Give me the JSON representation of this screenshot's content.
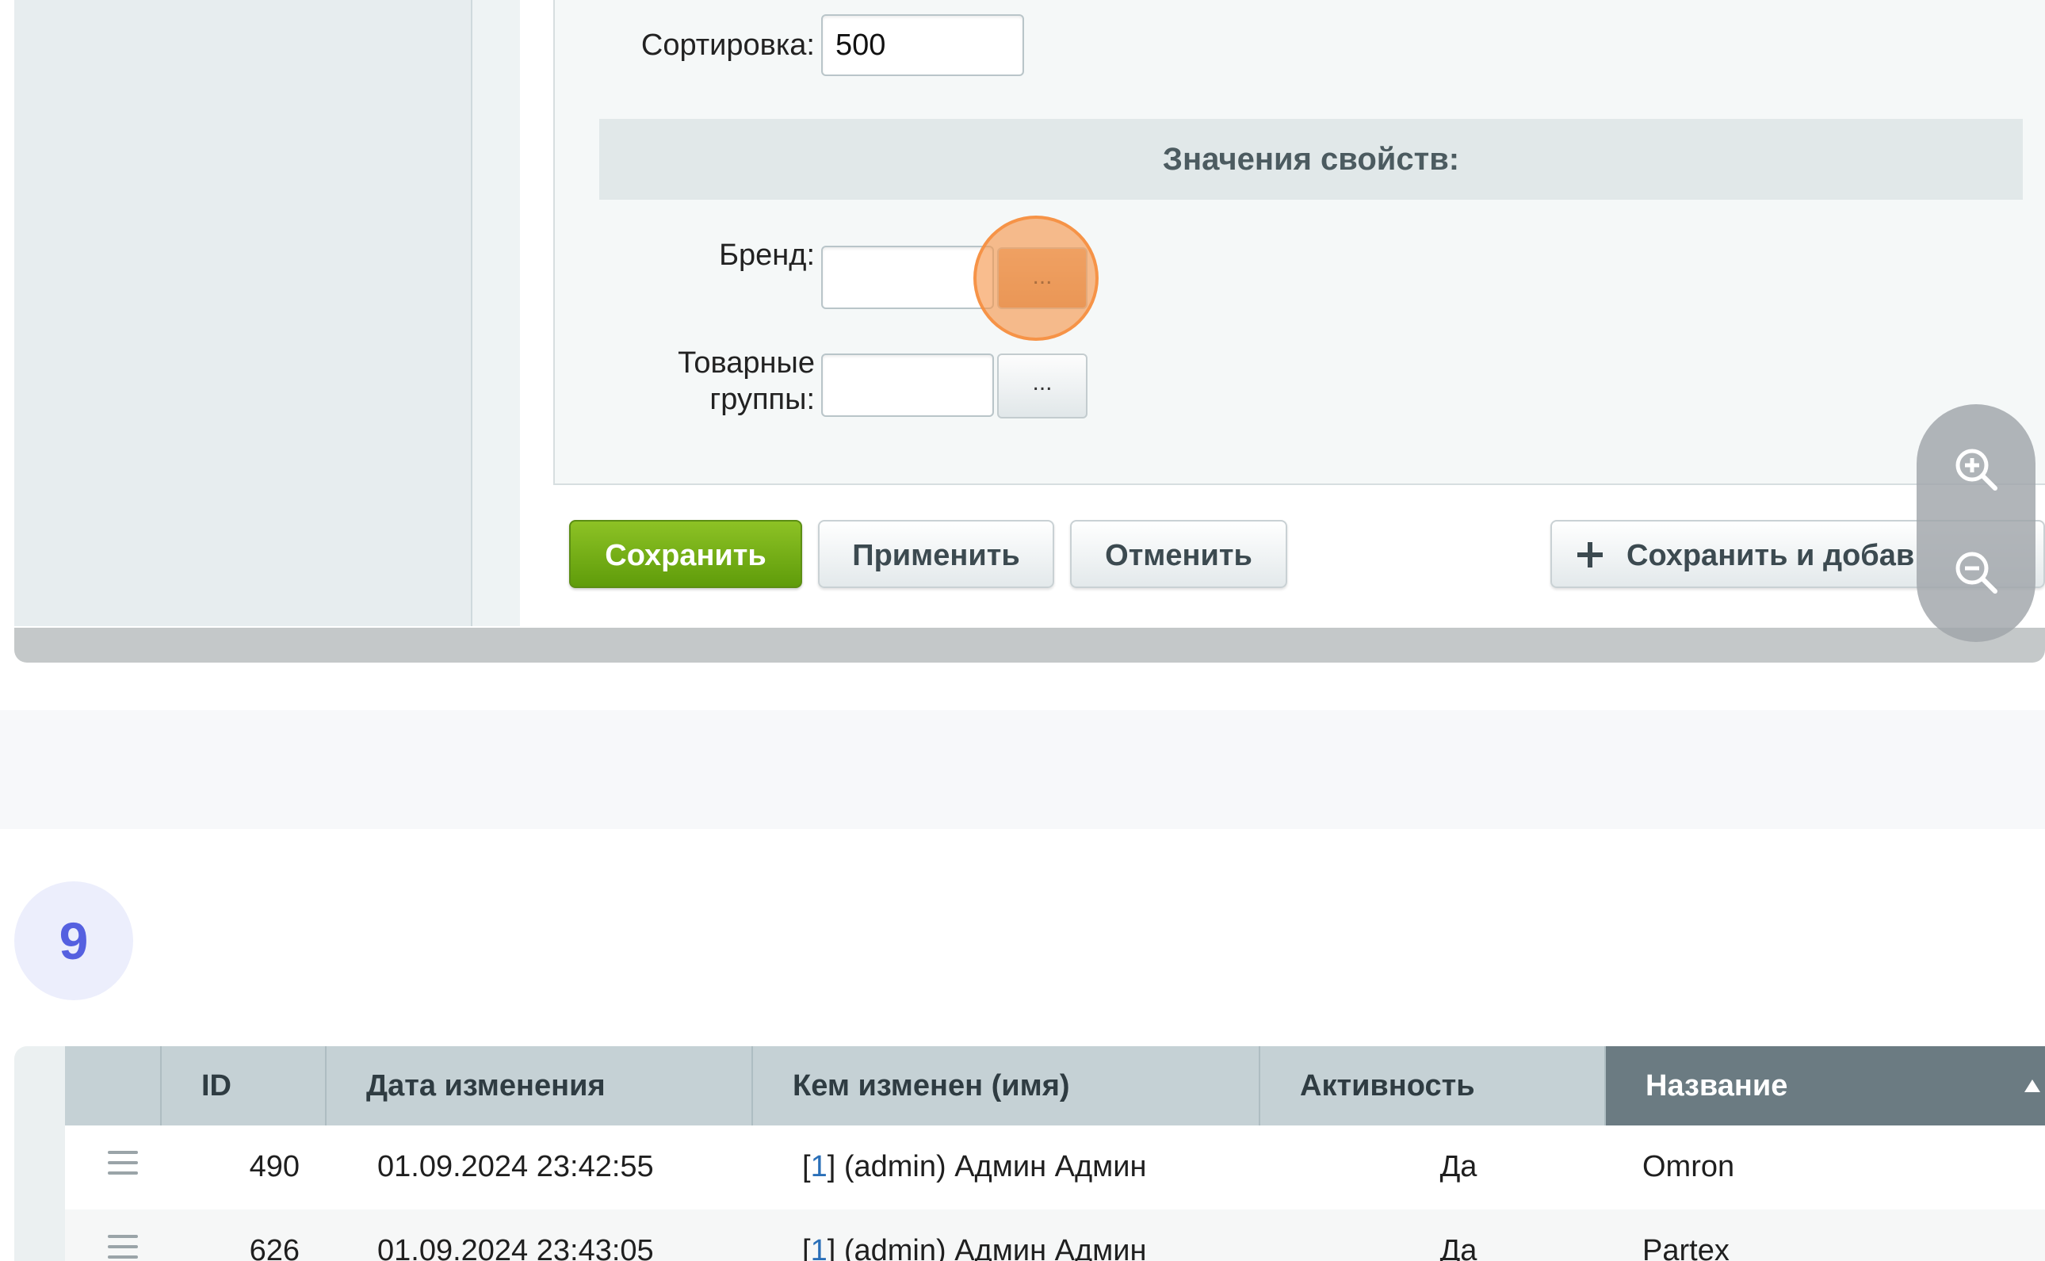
{
  "form": {
    "sort_label": "Сортировка:",
    "sort_value": "500",
    "section_title": "Значения свойств:",
    "brand_label": "Бренд:",
    "brand_value": "",
    "groups_label_line1": "Товарные",
    "groups_label_line2": "группы:",
    "groups_value": "",
    "picker_button": "...",
    "highlight_color": "#f69448"
  },
  "buttons": {
    "save": "Сохранить",
    "apply": "Применить",
    "cancel": "Отменить",
    "save_add": "Сохранить и добав"
  },
  "zoom": {
    "zoom_in_icon": "zoom-in-icon",
    "zoom_out_icon": "zoom-out-icon"
  },
  "step": {
    "number": "9",
    "color": "#5560e0"
  },
  "table": {
    "columns": [
      "ID",
      "Дата изменения",
      "Кем изменен (имя)",
      "Активность",
      "Название"
    ],
    "sorted_column": "Название",
    "rows": [
      {
        "id": "490",
        "date": "01.09.2024 23:42:55",
        "user_id": "1",
        "user_name": "(admin) Админ Админ",
        "active": "Да",
        "name": "Omron"
      },
      {
        "id": "626",
        "date": "01.09.2024 23:43:05",
        "user_id": "1",
        "user_name": "(admin) Админ Админ",
        "active": "Да",
        "name": "Partex"
      }
    ]
  },
  "colors": {
    "save_button": "#6fae14",
    "header_active": "#6b7b82",
    "link": "#2a6fb8"
  }
}
